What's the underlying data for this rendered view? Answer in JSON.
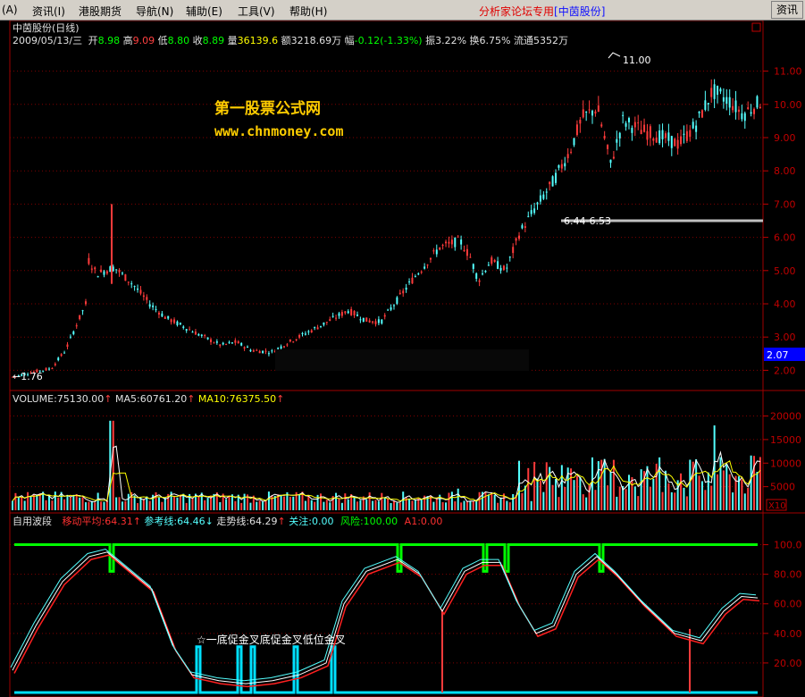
{
  "menus": [
    {
      "label": "(A)"
    },
    {
      "label": "资讯(I)"
    },
    {
      "label": "港股期货"
    },
    {
      "label": "导航(N)"
    },
    {
      "label": "辅助(E)"
    },
    {
      "label": "工具(V)"
    },
    {
      "label": "帮助(H)"
    }
  ],
  "forum_text": "分析家论坛专用",
  "stock_badge": "[中茵股份]",
  "info_button": "资讯",
  "chart": {
    "title": "中茵股份(日线)",
    "quote": {
      "date": "2009/05/13/三",
      "open_label": "开",
      "open": "8.98",
      "high_label": "高",
      "high": "9.09",
      "low_label": "低",
      "low": "8.80",
      "close_label": "收",
      "close": "8.89",
      "vol_label": "量",
      "vol": "36139.6",
      "amount_label": "额",
      "amount": "3218.69万",
      "change_label": "幅",
      "change": "-0.12(-1.33%)",
      "amplitude_label": "振",
      "amplitude": "3.22%",
      "turnover_label": "换",
      "turnover": "6.75%",
      "float_label": "流通",
      "float": "5352万"
    },
    "watermark_1": "第一股票公式网",
    "watermark_2": "www.chnmoney.com",
    "price_axis": [
      "11.00",
      "10.00",
      "9.00",
      "8.00",
      "7.00",
      "6.00",
      "5.00",
      "4.00",
      "3.00",
      "2.00"
    ],
    "price_range": [
      1.5,
      11.5
    ],
    "current_price": "2.07",
    "annot_high": "11.00",
    "annot_low": "←1.76",
    "annot_range": "6.44-6.53",
    "support_level": 6.5
  },
  "volume": {
    "label": "VOLUME:75130.00",
    "ma5": "MA5:60761.20",
    "ma10": "MA10:76375.50",
    "axis": [
      "20000",
      "15000",
      "10000",
      "5000"
    ],
    "range": [
      0,
      22000
    ],
    "unit": "X10"
  },
  "indicator": {
    "name": "自用波段",
    "ma": "移动平均:64.31",
    "ref": "参考线:64.46",
    "trend": "走势线:64.29",
    "watch": "关注:0.00",
    "risk": "风险:100.00",
    "a1": "A1:0.00",
    "axis": [
      "100.0",
      "80.00",
      "60.00",
      "40.00",
      "20.00"
    ],
    "signal_text": "☆一底促金叉底促金叉低位金叉"
  },
  "colors": {
    "up": "#ff3b3b",
    "down": "#54ffff",
    "grid": "#800000",
    "axis": "#c00000",
    "green": "#00ff00",
    "cyan": "#00ffff",
    "yellow": "#ffff00",
    "white": "#ffffff",
    "gold": "#ffcc00"
  }
}
